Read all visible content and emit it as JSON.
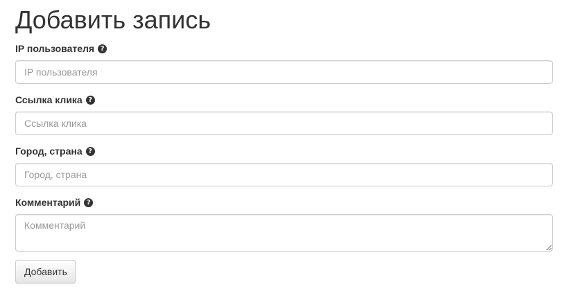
{
  "page": {
    "title": "Добавить запись"
  },
  "form": {
    "fields": [
      {
        "label": "IP пользователя",
        "placeholder": "IP пользователя",
        "value": "",
        "help_icon": "question-circle-icon"
      },
      {
        "label": "Ссылка клика",
        "placeholder": "Ссылка клика",
        "value": "",
        "help_icon": "question-circle-icon"
      },
      {
        "label": "Город, страна",
        "placeholder": "Город, страна",
        "value": "",
        "help_icon": "question-circle-icon"
      },
      {
        "label": "Комментарий",
        "placeholder": "Комментарий",
        "value": "",
        "help_icon": "question-circle-icon"
      }
    ],
    "submit_label": "Добавить"
  },
  "colors": {
    "text": "#333333",
    "border": "#cccccc",
    "placeholder": "#999999"
  }
}
